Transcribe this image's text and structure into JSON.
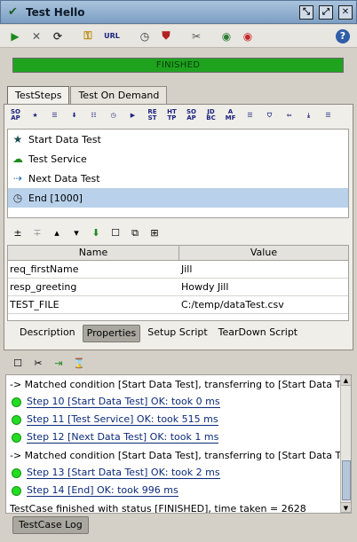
{
  "window": {
    "title": "Test Hello"
  },
  "progress": {
    "status_text": "FINISHED",
    "percent": 100,
    "color": "#1fa31f"
  },
  "tabs": [
    {
      "label": "TestSteps"
    },
    {
      "label": "Test On Demand"
    }
  ],
  "steps_toolbar": [
    {
      "label": "SO\nAP"
    },
    {
      "label": "★"
    },
    {
      "label": "☰"
    },
    {
      "label": "⬇"
    },
    {
      "label": "☷"
    },
    {
      "label": "◷"
    },
    {
      "label": "▶"
    },
    {
      "label": "RE\nST"
    },
    {
      "label": "HT\nTP"
    },
    {
      "label": "SO\nAP"
    },
    {
      "label": "JD\nBC"
    },
    {
      "label": "A\nMF"
    },
    {
      "label": "☰"
    },
    {
      "label": "⛉"
    },
    {
      "label": "⇦"
    },
    {
      "label": "⤓"
    },
    {
      "label": "☰"
    }
  ],
  "steps": [
    {
      "label": "Start Data Test",
      "icon": "star-icon"
    },
    {
      "label": "Test Service",
      "icon": "soap-icon"
    },
    {
      "label": "Next Data Test",
      "icon": "loop-icon"
    },
    {
      "label": "End [1000]",
      "icon": "clock-icon",
      "selected": true
    }
  ],
  "properties": {
    "headers": [
      "Name",
      "Value"
    ],
    "rows": [
      {
        "name": "req_firstName",
        "value": "Jill"
      },
      {
        "name": "resp_greeting",
        "value": "Howdy Jill"
      },
      {
        "name": "TEST_FILE",
        "value": "C:/temp/dataTest.csv"
      }
    ]
  },
  "subtabs": [
    {
      "label": "Description"
    },
    {
      "label": "Properties",
      "active": true
    },
    {
      "label": "Setup Script"
    },
    {
      "label": "TearDown Script"
    }
  ],
  "log": [
    {
      "type": "text",
      "text": "-> Matched condition [Start Data Test], transferring to [Start Data Test]"
    },
    {
      "type": "step",
      "text": "Step 10 [Start Data Test] OK: took 0 ms"
    },
    {
      "type": "step",
      "text": "Step 11 [Test Service] OK: took 515 ms"
    },
    {
      "type": "step",
      "text": "Step 12 [Next Data Test] OK: took 1 ms"
    },
    {
      "type": "text",
      "text": "-> Matched condition [Start Data Test], transferring to [Start Data Test]"
    },
    {
      "type": "step",
      "text": "Step 13 [Start Data Test] OK: took 2 ms"
    },
    {
      "type": "step",
      "text": "Step 14 [End] OK: took 996 ms"
    },
    {
      "type": "text",
      "text": "TestCase finished with status [FINISHED], time taken = 2628"
    }
  ],
  "bottom_tab": {
    "label": "TestCase Log"
  },
  "toolbar": {
    "url_label": "URL"
  }
}
